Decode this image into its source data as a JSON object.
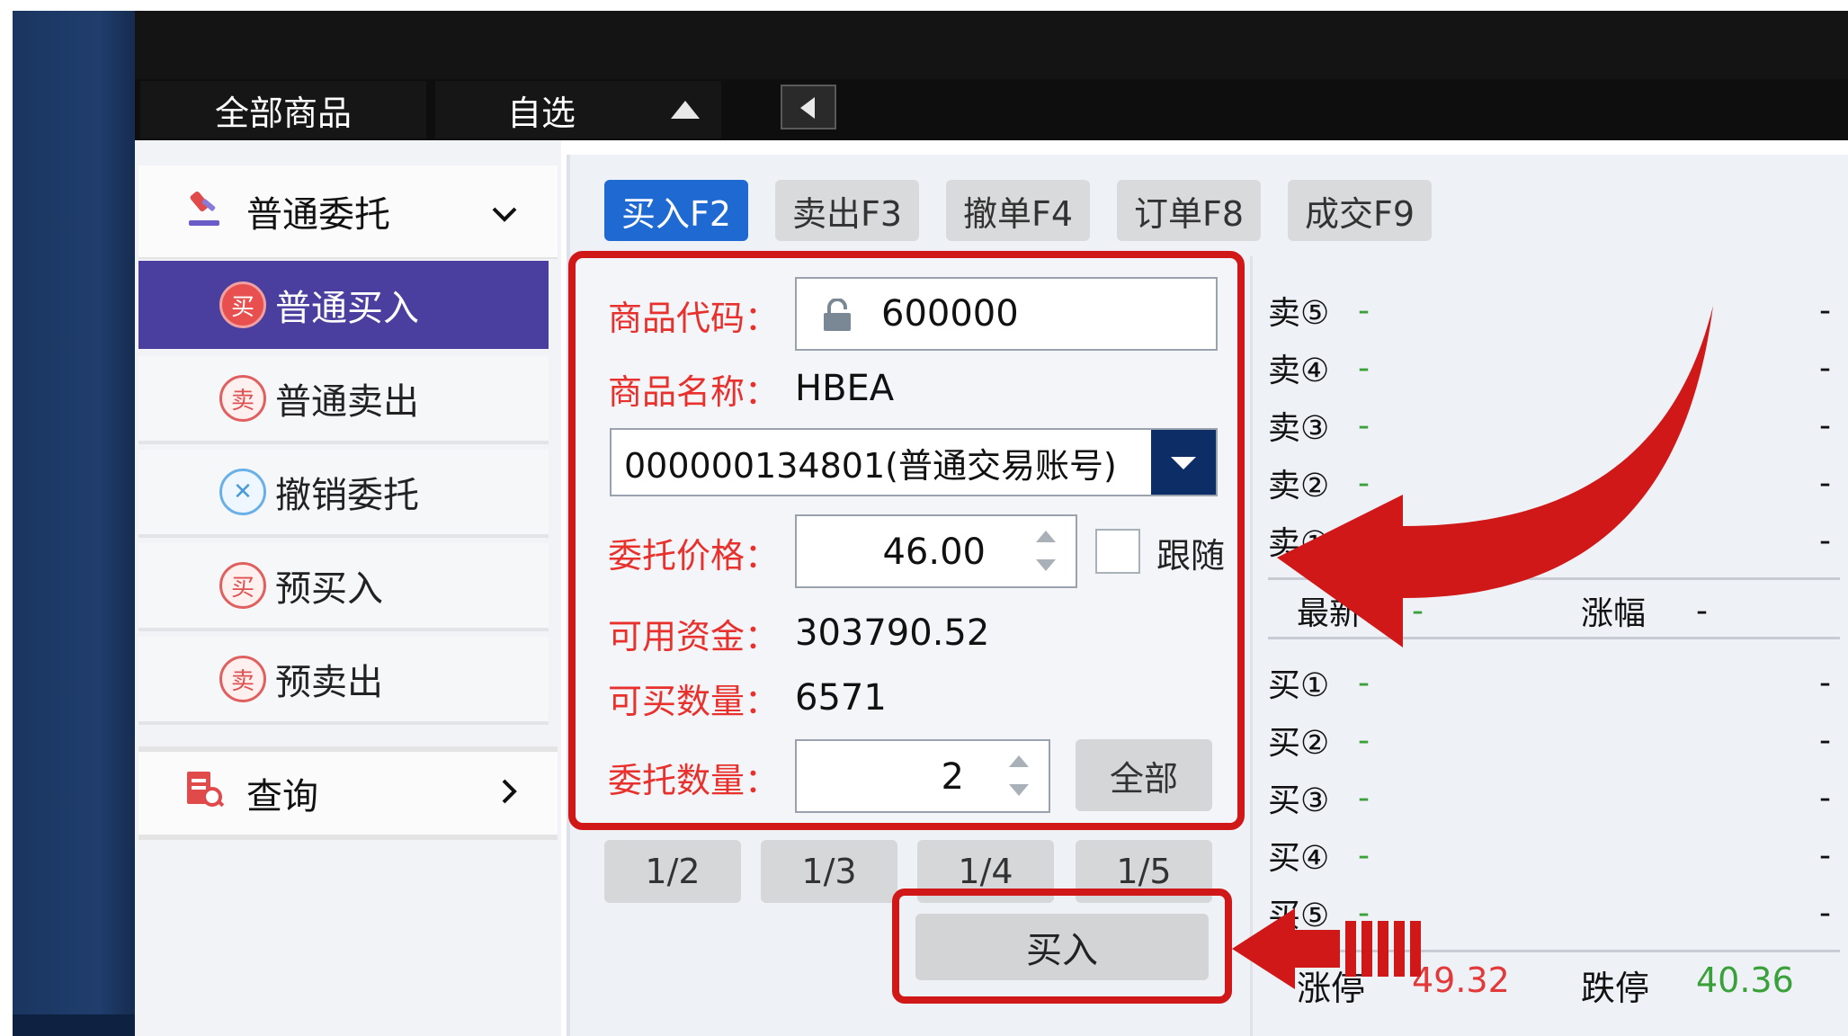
{
  "top_tabs": {
    "all_goods": "全部商品",
    "favorites": "自选"
  },
  "sidebar": {
    "entrust_group": "普通委托",
    "items": [
      {
        "label": "普通买入",
        "icon": "买",
        "active": true
      },
      {
        "label": "普通卖出",
        "icon": "卖",
        "active": false
      },
      {
        "label": "撤销委托",
        "icon": "✕",
        "active": false
      },
      {
        "label": "预买入",
        "icon": "买",
        "active": false
      },
      {
        "label": "预卖出",
        "icon": "卖",
        "active": false
      }
    ],
    "query_group": "查询"
  },
  "func_tabs": [
    "买入F2",
    "卖出F3",
    "撤单F4",
    "订单F8",
    "成交F9"
  ],
  "form": {
    "code_label": "商品代码：",
    "code_value": "600000",
    "name_label": "商品名称：",
    "name_value": "HBEA",
    "account_value": "000000134801(普通交易账号)",
    "price_label": "委托价格：",
    "price_value": "46.00",
    "follow_label": "跟随",
    "funds_label": "可用资金：",
    "funds_value": "303790.52",
    "buyable_label": "可买数量：",
    "buyable_value": "6571",
    "qty_label": "委托数量：",
    "qty_value": "2",
    "all_button": "全部",
    "fractions": [
      "1/2",
      "1/3",
      "1/4",
      "1/5"
    ],
    "buy_button": "买入"
  },
  "order_book": {
    "sell_labels": [
      "卖⑤",
      "卖④",
      "卖③",
      "卖②",
      "卖①"
    ],
    "buy_labels": [
      "买①",
      "买②",
      "买③",
      "买④",
      "买⑤"
    ],
    "placeholder": "-",
    "last_label": "最新",
    "change_label": "涨幅",
    "limit_up_label": "涨停",
    "limit_up_value": "49.32",
    "limit_down_label": "跌停",
    "limit_down_value": "40.36"
  },
  "colors": {
    "accent_blue": "#1f6ad2",
    "active_purple": "#4a3f9e",
    "label_red": "#e8302c",
    "highlight_red": "#d01818",
    "down_green": "#3aa03a"
  }
}
